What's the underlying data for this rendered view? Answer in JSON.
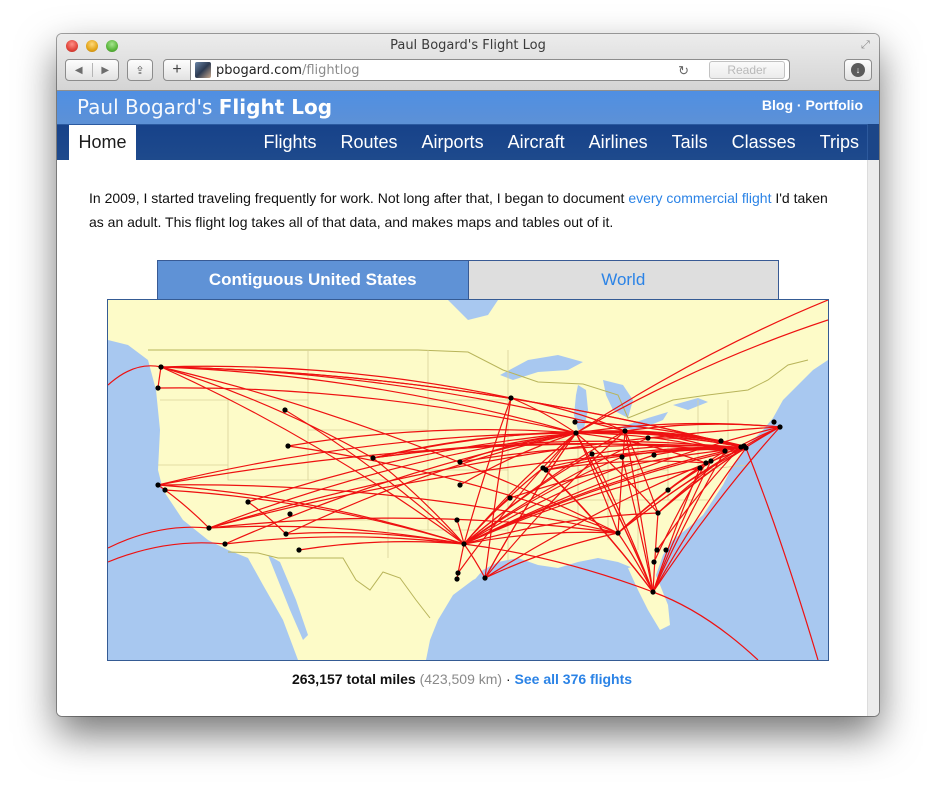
{
  "browser": {
    "window_title": "Paul Bogard's Flight Log",
    "url_domain": "pbogard.com",
    "url_path": "/flightlog",
    "reader_label": "Reader",
    "back_glyph": "◀",
    "forward_glyph": "▶",
    "add_glyph": "+",
    "share_glyph": "⇪",
    "reload_glyph": "↻",
    "download_glyph": "↓",
    "fullscreen_glyph": "⤢"
  },
  "header": {
    "title_light": "Paul Bogard's ",
    "title_bold": "Flight Log",
    "links": [
      {
        "label": "Blog"
      },
      {
        "label": "Portfolio"
      }
    ],
    "link_separator": " · "
  },
  "nav": {
    "home": "Home",
    "items": [
      {
        "label": "Flights"
      },
      {
        "label": "Routes"
      },
      {
        "label": "Airports"
      },
      {
        "label": "Aircraft"
      },
      {
        "label": "Airlines"
      },
      {
        "label": "Tails"
      },
      {
        "label": "Classes"
      },
      {
        "label": "Trips"
      }
    ]
  },
  "intro": {
    "before_link": "In 2009, I started traveling frequently for work. Not long after that, I began to document ",
    "link_text": "every commercial flight",
    "after_link": " I'd taken as an adult. This flight log takes all of that data, and makes maps and tables out of it."
  },
  "map_tabs": [
    {
      "label": "Contiguous United States",
      "active": true
    },
    {
      "label": "World",
      "active": false
    }
  ],
  "map": {
    "region": "Contiguous United States",
    "colors": {
      "land": "#fdfbc8",
      "water": "#a8c8f0",
      "route": "#ee1111",
      "airport": "#000000",
      "border": "#c9c48a"
    }
  },
  "totals": {
    "miles": "263,157 total miles",
    "km": "(423,509 km)",
    "separator": " · ",
    "link": "See all 376 flights"
  }
}
